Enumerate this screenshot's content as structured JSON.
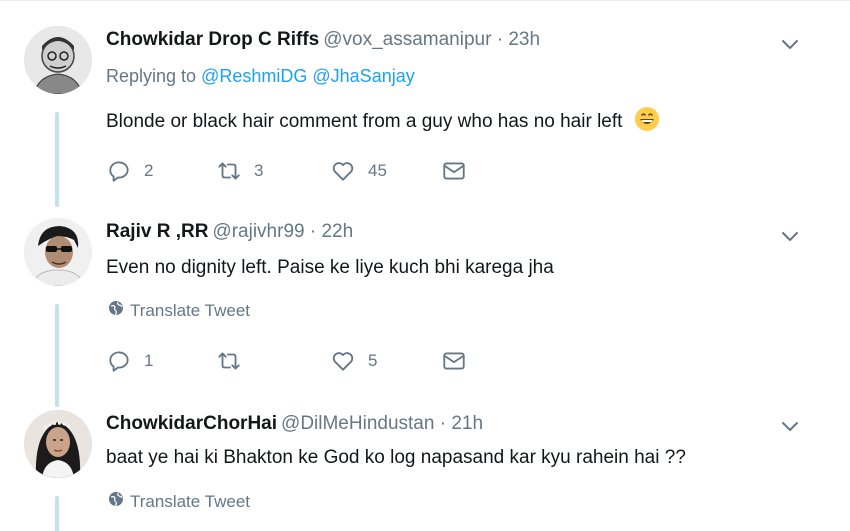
{
  "tweets": [
    {
      "name": "Chowkidar Drop C Riffs",
      "handle": "@vox_assamanipur",
      "separator": "·",
      "time": "23h",
      "replying_prefix": "Replying to",
      "mentions": [
        "@ReshmiDG",
        "@JhaSanjay"
      ],
      "text": "Blonde or black hair comment from a guy who has no hair left",
      "emoji": "grinning-face-emoji",
      "actions": {
        "reply_count": "2",
        "retweet_count": "3",
        "like_count": "45"
      }
    },
    {
      "name": "Rajiv R ,RR",
      "handle": "@rajivhr99",
      "separator": "·",
      "time": "22h",
      "text": "Even no dignity left. Paise ke liye kuch bhi karega jha",
      "translate_label": "Translate Tweet",
      "actions": {
        "reply_count": "1",
        "retweet_count": "",
        "like_count": "5"
      }
    },
    {
      "name": "ChowkidarChorHai",
      "handle": "@DilMeHindustan",
      "separator": "·",
      "time": "21h",
      "text": "baat ye hai ki Bhakton ke God ko log napasand kar kyu rahein hai ??",
      "translate_label": "Translate Tweet"
    }
  ],
  "colors": {
    "accent": "#1da1f2",
    "muted": "#657786",
    "thread_line": "#c4e0f3",
    "text": "#14171a"
  },
  "icons": [
    "reply-icon",
    "retweet-icon",
    "like-icon",
    "message-icon",
    "chevron-down-icon",
    "globe-icon"
  ]
}
